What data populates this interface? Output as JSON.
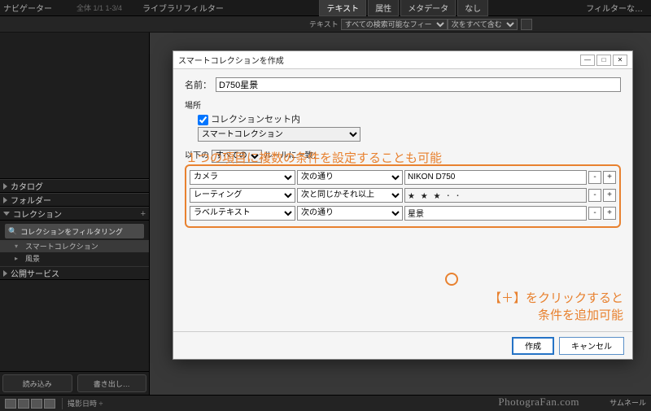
{
  "topbar": {
    "navigator": "ナビゲーター",
    "counter": "全体  1/1  1-3/4",
    "libfilter": "ライブラリフィルター",
    "tabs": [
      "テキスト",
      "属性",
      "メタデータ",
      "なし"
    ],
    "filter_none": "フィルターな…"
  },
  "filterbar": {
    "label": "テキスト",
    "sel1": "すべての検索可能なフィー",
    "sel2": "次をすべて含む"
  },
  "sidebar": {
    "panels": {
      "catalog": "カタログ",
      "folder": "フォルダー",
      "collection": "コレクション",
      "publish": "公開サービス"
    },
    "filter_coll": "コレクションをフィルタリング",
    "items": [
      {
        "icon": "▾",
        "label": "スマートコレクション"
      },
      {
        "icon": "▸",
        "label": "風景"
      }
    ],
    "import_btn": "読み込み",
    "export_btn": "書き出し…"
  },
  "dialog": {
    "title": "スマートコレクションを作成",
    "name_label": "名前：",
    "name_value": "D750星景",
    "location_label": "場所",
    "inside_label": "コレクションセット内",
    "inside_value": "スマートコレクション",
    "match_prefix": "以下の",
    "match_sel": "すべての",
    "match_suffix": "ルールに一致：",
    "rules": [
      {
        "field": "カメラ",
        "op": "次の通り",
        "val": "NIKON D750"
      },
      {
        "field": "レーティング",
        "op": "次と同じかそれ以上",
        "val": "★ ★ ★ ･ ･"
      },
      {
        "field": "ラベルテキスト",
        "op": "次の通り",
        "val": "星景"
      }
    ],
    "create": "作成",
    "cancel": "キャンセル"
  },
  "annotations": {
    "a1": "１つの項目に複数の条件を設定することも可能",
    "a2a": "【＋】をクリックすると",
    "a2b": "条件を追加可能"
  },
  "bottombar": {
    "sort_label": "撮影日時 ÷",
    "watermark": "PhotograFan.com",
    "thumbnail": "サムネール"
  }
}
